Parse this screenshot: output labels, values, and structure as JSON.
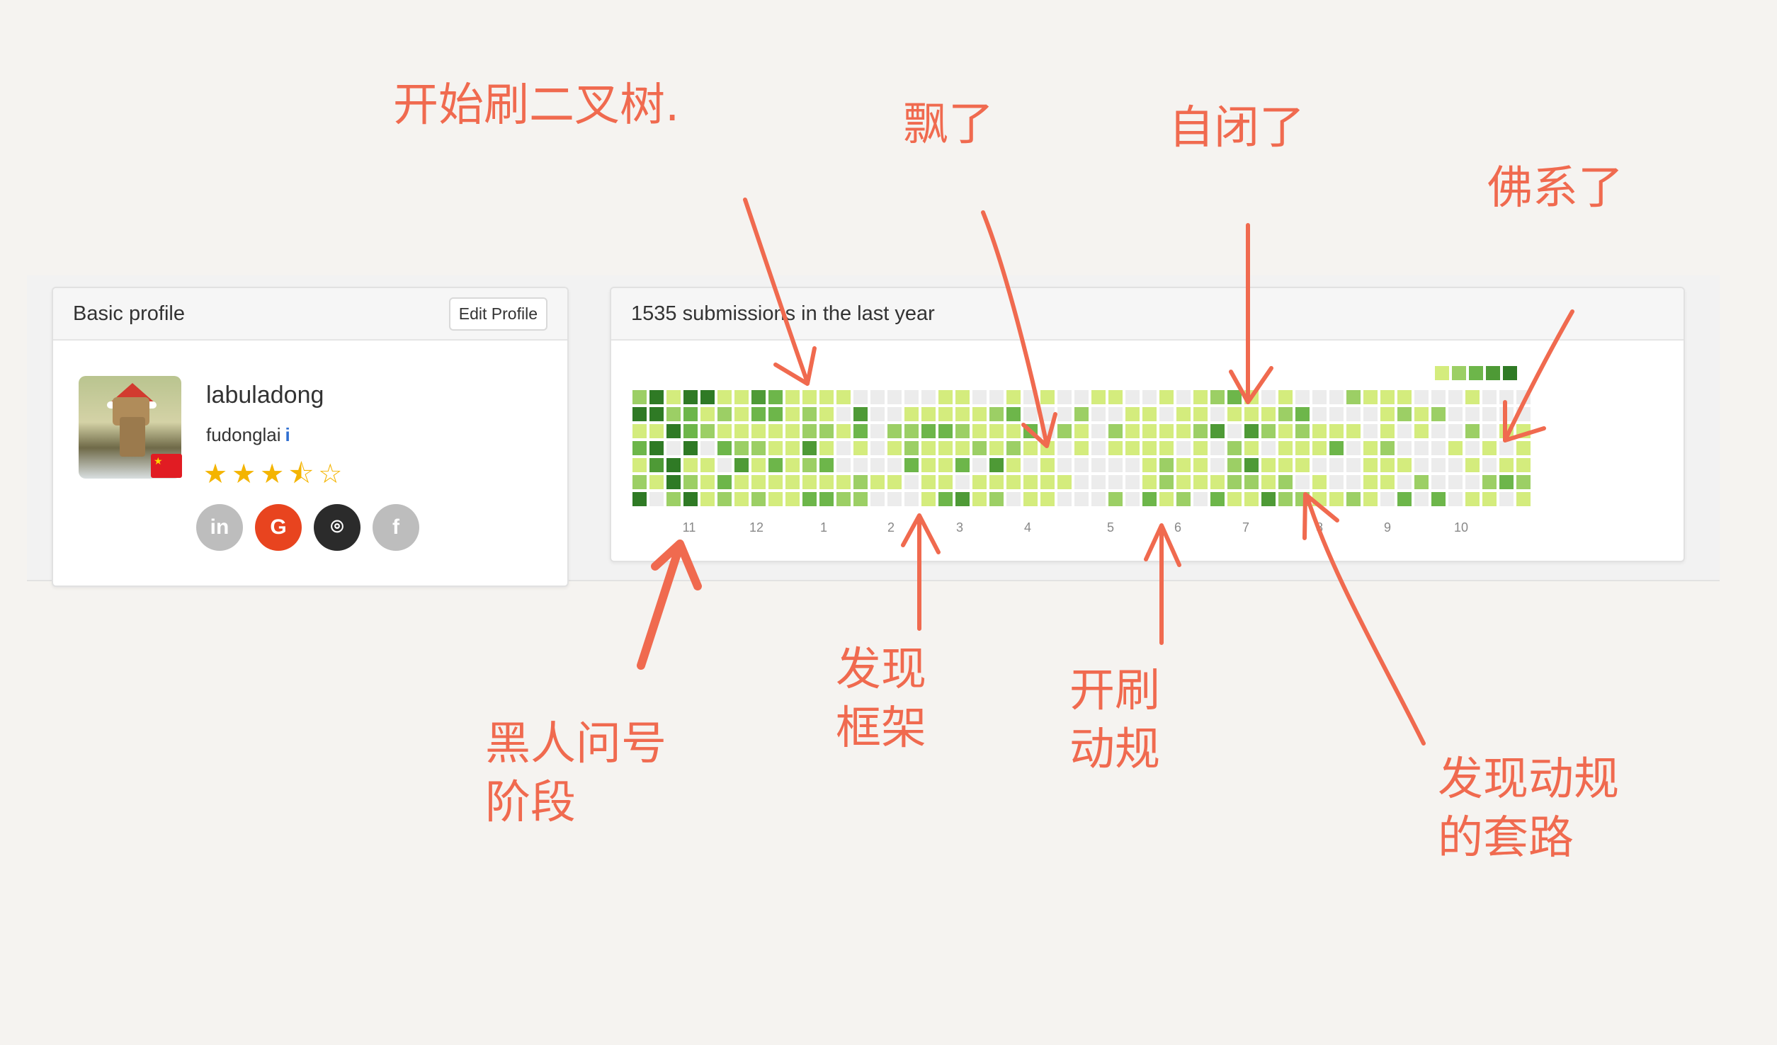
{
  "profile_card": {
    "title": "Basic profile",
    "edit_label": "Edit Profile",
    "username": "labuladong",
    "real_name": "fudonglai",
    "info_glyph": "i",
    "rating_stars": 3.5,
    "stars_total": 5,
    "social_links": [
      {
        "icon": "linkedin-icon",
        "glyph": "in",
        "color": "#bdbdbd"
      },
      {
        "icon": "google-icon",
        "glyph": "G",
        "color": "#e8441f"
      },
      {
        "icon": "github-icon",
        "glyph": "⌾",
        "color": "#2b2b2b"
      },
      {
        "icon": "facebook-icon",
        "glyph": "f",
        "color": "#bdbdbd"
      }
    ]
  },
  "heatmap_card": {
    "title": "1535 submissions in the last year",
    "month_labels": [
      "11",
      "12",
      "1",
      "2",
      "3",
      "4",
      "5",
      "6",
      "7",
      "8",
      "9",
      "10"
    ],
    "legend_colors": [
      "#d4ec7d",
      "#9ccf65",
      "#6db64a",
      "#4e9a36",
      "#2f7a25"
    ],
    "empty_color": "#ececec"
  },
  "annotations": [
    {
      "text": "开始刷二叉树."
    },
    {
      "text": "飘了"
    },
    {
      "text": "自闭了"
    },
    {
      "text": "佛系了"
    },
    {
      "text": "黑人问号\n阶段"
    },
    {
      "text": "发现\n框架"
    },
    {
      "text": "开刷\n动规"
    },
    {
      "text": "发现动规\n的套路"
    }
  ],
  "colors": {
    "annotation": "#f06a4f",
    "accent_green": "#6db64a"
  }
}
